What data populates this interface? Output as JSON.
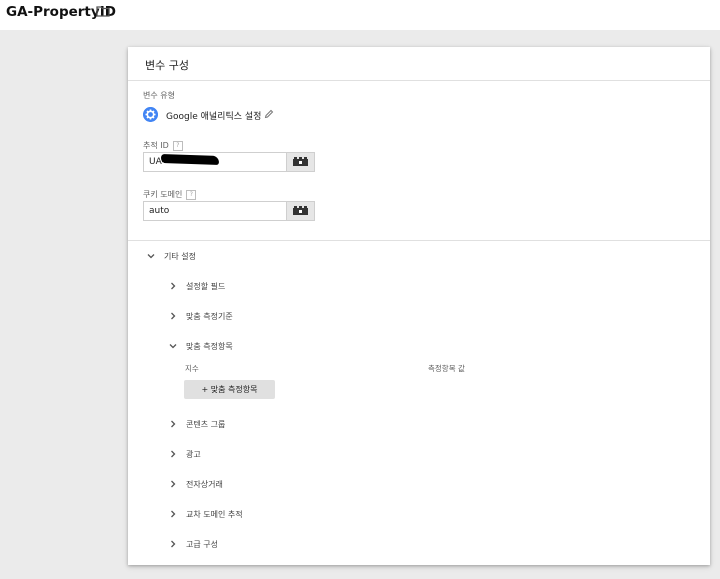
{
  "header": {
    "title": "GA-PropertyID",
    "folder_icon": "folder-icon"
  },
  "card": {
    "title": "변수 구성",
    "variable_type": {
      "label": "변수 유형",
      "name": "Google 애널리틱스 설정",
      "icon": "gear-icon",
      "icon_color": "#4285f4"
    },
    "tracking_id": {
      "label": "추적 ID",
      "help": "?",
      "value": "UA-"
    },
    "cookie_domain": {
      "label": "쿠키 도메인",
      "help": "?",
      "value": "auto"
    },
    "more_settings": {
      "label": "기타 설정",
      "expanded": true,
      "items": [
        {
          "label": "설정할 필드",
          "expanded": false
        },
        {
          "label": "맞춤 측정기준",
          "expanded": false
        },
        {
          "label": "맞춤 측정항목",
          "expanded": true,
          "columns": [
            "지수",
            "측정항목 값"
          ],
          "add_button": "+ 맞춤 측정항목"
        },
        {
          "label": "콘텐츠 그룹",
          "expanded": false
        },
        {
          "label": "광고",
          "expanded": false
        },
        {
          "label": "전자상거래",
          "expanded": false
        },
        {
          "label": "교차 도메인 추적",
          "expanded": false
        },
        {
          "label": "고급 구성",
          "expanded": false
        }
      ]
    }
  }
}
